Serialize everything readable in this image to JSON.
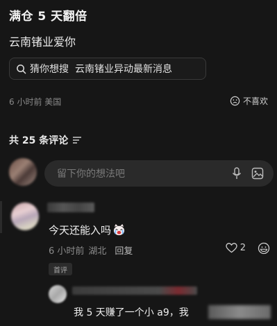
{
  "post": {
    "title": "满仓 5 天翻倍",
    "body": "云南锗业爱你",
    "search_chip": {
      "icon": "search-icon",
      "label": "猜你想搜",
      "query": "云南锗业异动最新消息"
    },
    "meta": "6 小时前  美国",
    "dislike_label": "不喜欢"
  },
  "comments_header": {
    "label": "共 25 条评论"
  },
  "composer": {
    "placeholder": "留下你的想法吧",
    "icons": [
      "microphone-icon",
      "image-icon"
    ]
  },
  "comments": [
    {
      "text": "今天还能入吗",
      "emoji": "crying-cat-emoji",
      "time": "6 小时前",
      "location": "湖北",
      "reply_label": "回复",
      "likes": "2",
      "badge": "首评"
    }
  ],
  "reply_preview": {
    "text": "我 5 天赚了一个小 a9，我"
  },
  "colors": {
    "background": "#161616",
    "input": "#2a2a2a",
    "muted": "#8a8a8a"
  }
}
